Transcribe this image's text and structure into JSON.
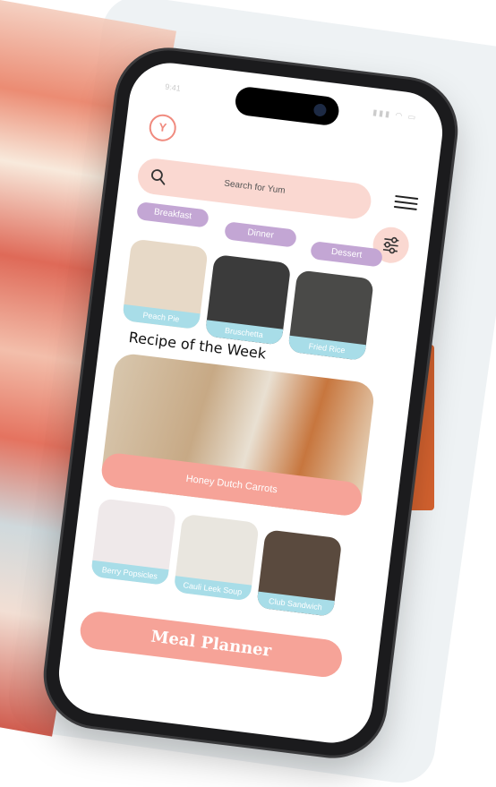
{
  "status": {
    "time": "9:41",
    "icons": "▮▮▮ ◠ ▭"
  },
  "app": {
    "logo_text": "Y"
  },
  "search": {
    "placeholder": "Search for Yum"
  },
  "categories": [
    "Breakfast",
    "Dinner",
    "Dessert"
  ],
  "top_recipes": [
    {
      "label": "Peach Pie",
      "color": "#e7d9c7"
    },
    {
      "label": "Bruschetta",
      "color": "#3b3b3b"
    },
    {
      "label": "Fried Rice",
      "color": "#4a4a48"
    }
  ],
  "recipe_of_week": {
    "heading": "Recipe of the Week",
    "label": "Honey Dutch Carrots"
  },
  "bottom_recipes": [
    {
      "label": "Berry Popsicles",
      "color": "#efe9ea"
    },
    {
      "label": "Cauli Leek Soup",
      "color": "#e9e6df"
    },
    {
      "label": "Club Sandwich",
      "color": "#5a4a3e"
    }
  ],
  "meal_planner": {
    "label": "Meal Planner"
  },
  "colors": {
    "pink": "#fad8d1",
    "salmon": "#f6a398",
    "lavender": "#c3a6d4",
    "teal": "#a8dde8"
  }
}
